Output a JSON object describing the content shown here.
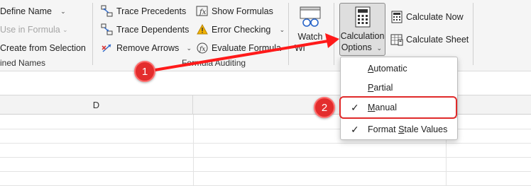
{
  "ribbon": {
    "defined_names": {
      "define_name": "Define Name",
      "use_in_formula": "Use in Formula",
      "create_from_selection": "Create from Selection",
      "group_label": "ined Names"
    },
    "formula_auditing": {
      "trace_precedents": "Trace Precedents",
      "trace_dependents": "Trace Dependents",
      "remove_arrows": "Remove Arrows",
      "show_formulas": "Show Formulas",
      "error_checking": "Error Checking",
      "evaluate_formula": "Evaluate Formula",
      "group_label": "Formula Auditing"
    },
    "watch_window": {
      "line1": "Watch",
      "line2": "Wi"
    },
    "calculation": {
      "options_line1": "Calculation",
      "options_line2": "Options",
      "calculate_now": "Calculate Now",
      "calculate_sheet": "Calculate Sheet"
    }
  },
  "sheet": {
    "column_d": "D"
  },
  "calc_menu": {
    "items": [
      {
        "label_u": "A",
        "label_rest": "utomatic",
        "checked": false
      },
      {
        "label_u": "P",
        "label_rest": "artial",
        "checked": false
      },
      {
        "label_u": "M",
        "label_rest": "anual",
        "checked": true
      },
      {
        "label_pre": "Format ",
        "label_u": "S",
        "label_rest": "tale Values",
        "checked": true
      }
    ],
    "check_glyph": "✓"
  },
  "annotations": {
    "badge1": "1",
    "badge2": "2",
    "accent_color": "#e02a2a"
  }
}
